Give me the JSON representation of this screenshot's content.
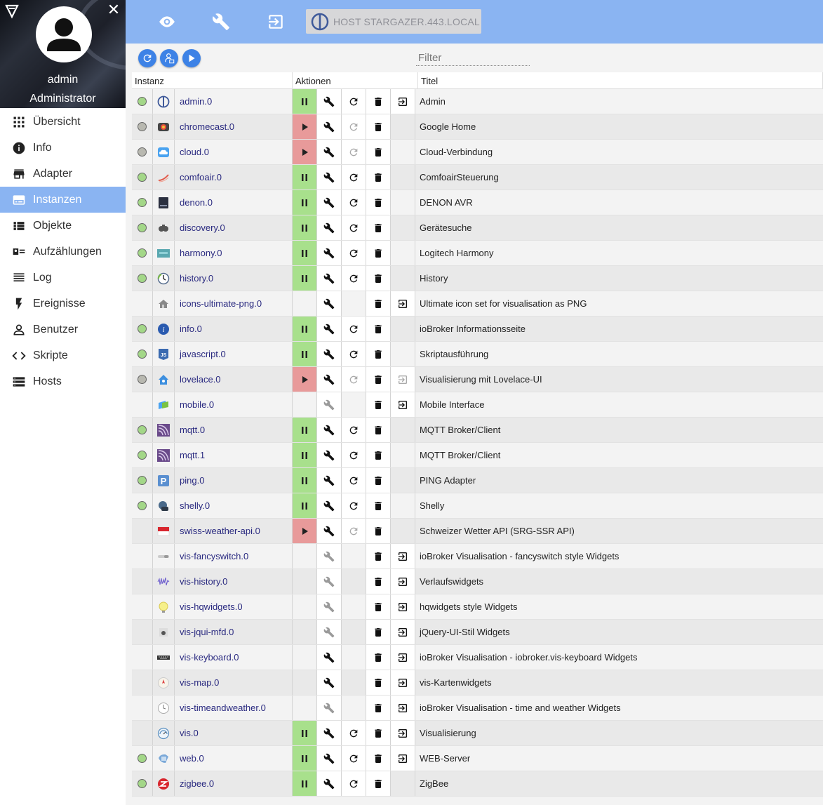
{
  "sidebar": {
    "user_name": "admin",
    "user_role": "Administrator",
    "nav": [
      {
        "label": "Übersicht",
        "icon": "apps-icon",
        "active": false
      },
      {
        "label": "Info",
        "icon": "info-icon",
        "active": false
      },
      {
        "label": "Adapter",
        "icon": "store-icon",
        "active": false
      },
      {
        "label": "Instanzen",
        "icon": "instances-icon",
        "active": true
      },
      {
        "label": "Objekte",
        "icon": "list-icon",
        "active": false
      },
      {
        "label": "Aufzählungen",
        "icon": "enum-icon",
        "active": false
      },
      {
        "label": "Log",
        "icon": "log-icon",
        "active": false
      },
      {
        "label": "Ereignisse",
        "icon": "flash-icon",
        "active": false
      },
      {
        "label": "Benutzer",
        "icon": "user-icon",
        "active": false
      },
      {
        "label": "Skripte",
        "icon": "code-icon",
        "active": false
      },
      {
        "label": "Hosts",
        "icon": "storage-icon",
        "active": false
      }
    ]
  },
  "topbar": {
    "host_label": "HOST STARGAZER.443.LOCAL"
  },
  "filter": {
    "placeholder": "Filter"
  },
  "table": {
    "headers": {
      "instance": "Instanz",
      "actions": "Aktionen",
      "title": "Titel"
    },
    "rows": [
      {
        "name": "admin.0",
        "title": "Admin",
        "status": "green",
        "state": "running",
        "settings": "active",
        "restart": "active",
        "link": true,
        "icon": "admin-icon"
      },
      {
        "name": "chromecast.0",
        "title": "Google Home",
        "status": "grey",
        "state": "stopped",
        "settings": "active",
        "restart": "disabled",
        "link": false,
        "icon": "chromecast-icon"
      },
      {
        "name": "cloud.0",
        "title": "Cloud-Verbindung",
        "status": "grey",
        "state": "stopped",
        "settings": "active",
        "restart": "disabled",
        "link": false,
        "icon": "cloud-icon"
      },
      {
        "name": "comfoair.0",
        "title": "ComfoairSteuerung",
        "status": "green",
        "state": "running",
        "settings": "active",
        "restart": "active",
        "link": false,
        "icon": "comfoair-icon"
      },
      {
        "name": "denon.0",
        "title": "DENON AVR",
        "status": "green",
        "state": "running",
        "settings": "active",
        "restart": "active",
        "link": false,
        "icon": "denon-icon"
      },
      {
        "name": "discovery.0",
        "title": "Gerätesuche",
        "status": "green",
        "state": "running",
        "settings": "active",
        "restart": "active",
        "link": false,
        "icon": "discovery-icon"
      },
      {
        "name": "harmony.0",
        "title": "Logitech Harmony",
        "status": "green",
        "state": "running",
        "settings": "active",
        "restart": "active",
        "link": false,
        "icon": "harmony-icon"
      },
      {
        "name": "history.0",
        "title": "History",
        "status": "green",
        "state": "running",
        "settings": "active",
        "restart": "active",
        "link": false,
        "icon": "history-icon"
      },
      {
        "name": "icons-ultimate-png.0",
        "title": "Ultimate icon set for visualisation as PNG",
        "status": "none",
        "state": "none",
        "settings": "active",
        "restart": "none",
        "link": true,
        "icon": "house-icon"
      },
      {
        "name": "info.0",
        "title": "ioBroker Informationsseite",
        "status": "green",
        "state": "running",
        "settings": "active",
        "restart": "active",
        "link": false,
        "icon": "info-adapter-icon"
      },
      {
        "name": "javascript.0",
        "title": "Skriptausführung",
        "status": "green",
        "state": "running",
        "settings": "active",
        "restart": "active",
        "link": false,
        "icon": "javascript-icon"
      },
      {
        "name": "lovelace.0",
        "title": "Visualisierung mit Lovelace-UI",
        "status": "grey",
        "state": "stopped",
        "settings": "active",
        "restart": "disabled",
        "link": "disabled",
        "icon": "lovelace-icon"
      },
      {
        "name": "mobile.0",
        "title": "Mobile Interface",
        "status": "none",
        "state": "none",
        "settings": "disabled",
        "restart": "none",
        "link": true,
        "icon": "mobile-icon"
      },
      {
        "name": "mqtt.0",
        "title": "MQTT Broker/Client",
        "status": "green",
        "state": "running",
        "settings": "active",
        "restart": "active",
        "link": false,
        "icon": "mqtt-icon"
      },
      {
        "name": "mqtt.1",
        "title": "MQTT Broker/Client",
        "status": "green",
        "state": "running",
        "settings": "active",
        "restart": "active",
        "link": false,
        "icon": "mqtt-icon"
      },
      {
        "name": "ping.0",
        "title": "PING Adapter",
        "status": "green",
        "state": "running",
        "settings": "active",
        "restart": "active",
        "link": false,
        "icon": "ping-icon"
      },
      {
        "name": "shelly.0",
        "title": "Shelly",
        "status": "green",
        "state": "running",
        "settings": "active",
        "restart": "active",
        "link": false,
        "icon": "shelly-icon"
      },
      {
        "name": "swiss-weather-api.0",
        "title": "Schweizer Wetter API (SRG-SSR API)",
        "status": "none",
        "state": "stopped",
        "settings": "active",
        "restart": "disabled",
        "link": false,
        "icon": "swiss-weather-icon"
      },
      {
        "name": "vis-fancyswitch.0",
        "title": "ioBroker Visualisation - fancyswitch style Widgets",
        "status": "none",
        "state": "none",
        "settings": "disabled",
        "restart": "none",
        "link": true,
        "icon": "fancyswitch-icon"
      },
      {
        "name": "vis-history.0",
        "title": "Verlaufswidgets",
        "status": "none",
        "state": "none",
        "settings": "disabled",
        "restart": "none",
        "link": true,
        "icon": "vis-history-icon"
      },
      {
        "name": "vis-hqwidgets.0",
        "title": "hqwidgets style Widgets",
        "status": "none",
        "state": "none",
        "settings": "disabled",
        "restart": "none",
        "link": true,
        "icon": "bulb-icon"
      },
      {
        "name": "vis-jqui-mfd.0",
        "title": "jQuery-UI-Stil Widgets",
        "status": "none",
        "state": "none",
        "settings": "disabled",
        "restart": "none",
        "link": true,
        "icon": "jqui-icon"
      },
      {
        "name": "vis-keyboard.0",
        "title": "ioBroker Visualisation - iobroker.vis-keyboard Widgets",
        "status": "none",
        "state": "none",
        "settings": "active",
        "restart": "none",
        "link": true,
        "icon": "keyboard-icon"
      },
      {
        "name": "vis-map.0",
        "title": "vis-Kartenwidgets",
        "status": "none",
        "state": "none",
        "settings": "active",
        "restart": "none",
        "link": true,
        "icon": "map-icon"
      },
      {
        "name": "vis-timeandweather.0",
        "title": "ioBroker Visualisation - time and weather Widgets",
        "status": "none",
        "state": "none",
        "settings": "disabled",
        "restart": "none",
        "link": true,
        "icon": "clock-icon"
      },
      {
        "name": "vis.0",
        "title": "Visualisierung",
        "status": "none",
        "state": "running",
        "settings": "active",
        "restart": "active",
        "link": true,
        "icon": "vis-icon"
      },
      {
        "name": "web.0",
        "title": "WEB-Server",
        "status": "green",
        "state": "running",
        "settings": "active",
        "restart": "active",
        "link": true,
        "icon": "web-icon"
      },
      {
        "name": "zigbee.0",
        "title": "ZigBee",
        "status": "green",
        "state": "running",
        "settings": "active",
        "restart": "active",
        "link": false,
        "icon": "zigbee-icon"
      }
    ]
  },
  "colors": {
    "accent": "#8ab4f2",
    "running": "#a8e08c",
    "stopped": "#e89a9a",
    "button_blue": "#3d82e6",
    "link_text": "#2a2a80"
  }
}
